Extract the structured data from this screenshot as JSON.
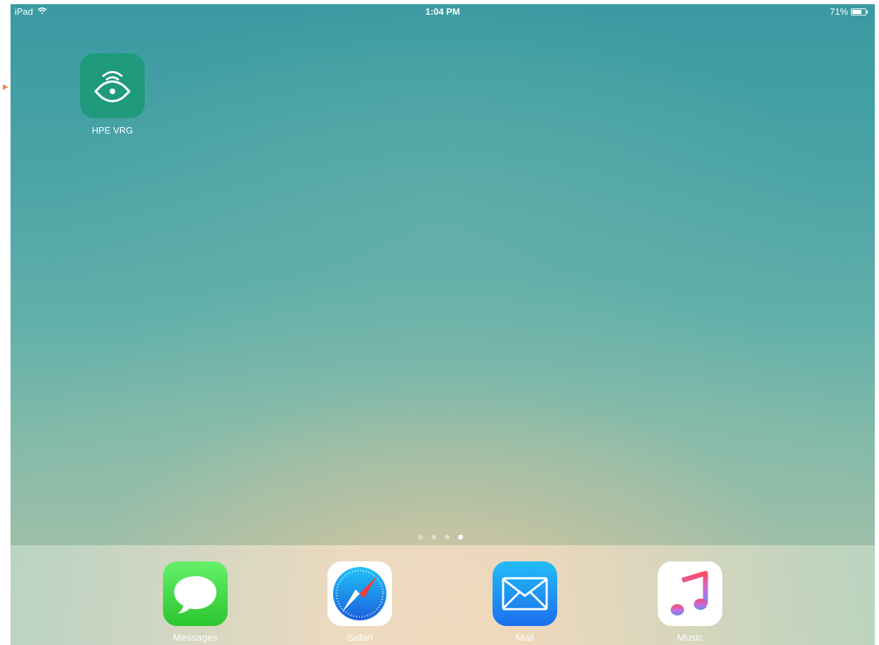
{
  "status_bar": {
    "device": "iPad",
    "time": "1:04 PM",
    "battery": "71%",
    "battery_level": 0.71,
    "wifi_icon": "wifi-icon",
    "battery_icon": "battery-icon"
  },
  "home": {
    "apps": [
      {
        "label": "HPE VRG",
        "icon": "eye-signal-icon",
        "color": "#1f9a7c"
      }
    ],
    "page_count": 4,
    "active_page": 4
  },
  "dock": {
    "apps": [
      {
        "label": "Messages",
        "icon": "speech-bubble-icon"
      },
      {
        "label": "Safari",
        "icon": "compass-icon"
      },
      {
        "label": "Mail",
        "icon": "envelope-icon"
      },
      {
        "label": "Music",
        "icon": "music-note-icon"
      }
    ]
  },
  "colors": {
    "accent_marker": "#f08a50"
  }
}
